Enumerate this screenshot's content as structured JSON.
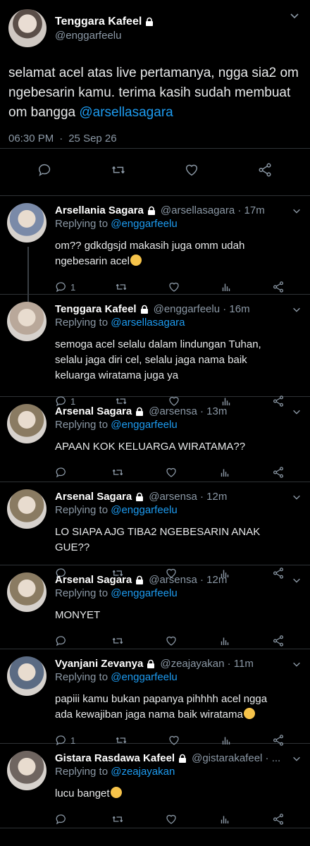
{
  "main": {
    "name": "Tenggara Kafeel",
    "handle": "@enggarfeelu",
    "text": "selamat acel atas live pertamanya, ngga sia2 om ngebesarin kamu. terima kasih sudah membuat om bangga ",
    "mention": "@arsellasagara",
    "time": "06:30 PM",
    "sep": "·",
    "date": "25 Sep 26"
  },
  "replies": [
    {
      "name": "Arsellania Sagara",
      "handle": "@arsellasagara · 17m",
      "replying": "Replying to ",
      "to": "@enggarfeelu",
      "text": "om?? gdkdgsjd makasih juga omm udah ngebesarin acel",
      "replies": "1",
      "avatar": "#7a8aa8"
    },
    {
      "name": "Tenggara Kafeel",
      "handle": "@enggarfeelu · 16m",
      "replying": "Replying to ",
      "to": "@arsellasagara",
      "text": "semoga acel selalu dalam lindungan Tuhan, selalu jaga diri cel, selalu jaga nama baik keluarga wiratama juga ya",
      "replies": "1",
      "avatar": "#b9a89a"
    },
    {
      "name": "Arsenal Sagara",
      "handle": "@arsensa · 13m",
      "replying": "Replying to ",
      "to": "@enggarfeelu",
      "text": "APAAN KOK KELUARGA WIRATAMA??",
      "replies": "",
      "avatar": "#8a7b62"
    },
    {
      "name": "Arsenal Sagara",
      "handle": "@arsensa · 12m",
      "replying": "Replying to ",
      "to": "@enggarfeelu",
      "text": "LO SIAPA AJG TIBA2 NGEBESARIN ANAK GUE??",
      "replies": "",
      "avatar": "#8a7b62"
    },
    {
      "name": "Arsenal Sagara",
      "handle": "@arsensa · 12m",
      "replying": "Replying to ",
      "to": "@enggarfeelu",
      "text": "MONYET",
      "replies": "",
      "avatar": "#8a7b62"
    },
    {
      "name": "Vyanjani Zevanya",
      "handle": "@zeajayakan · 11m",
      "replying": "Replying to ",
      "to": "@enggarfeelu",
      "text": "papiii kamu bukan papanya pihhhh acel ngga ada kewajiban jaga nama baik wiratama",
      "replies": "1",
      "avatar": "#5b6b83"
    },
    {
      "name": "Gistara Rasdawa Kafeel",
      "handle": "@gistarakafeel · ...",
      "replying": "Replying to ",
      "to": "@zeajayakan",
      "text": "lucu banget",
      "replies": "",
      "avatar": "#6f6560"
    }
  ]
}
